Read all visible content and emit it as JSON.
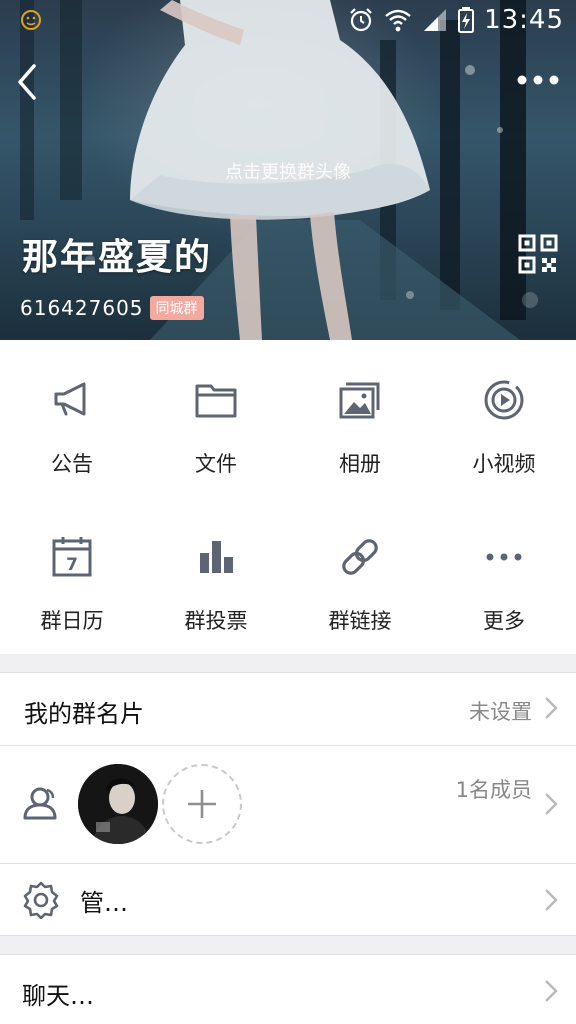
{
  "status_bar": {
    "time": "13:45",
    "icons": [
      "emoji-notification-icon",
      "alarm-icon",
      "wifi-icon",
      "cell-signal-icon",
      "battery-charging-icon"
    ]
  },
  "header": {
    "change_avatar_text": "点击更换群头像",
    "group_name": "那年盛夏的",
    "group_id": "616427605",
    "group_badge": "同城群",
    "badge_color": "#f3a99e"
  },
  "grid": {
    "items": [
      {
        "label": "公告",
        "icon": "megaphone-icon"
      },
      {
        "label": "文件",
        "icon": "folder-icon"
      },
      {
        "label": "相册",
        "icon": "photo-album-icon"
      },
      {
        "label": "小视频",
        "icon": "video-play-icon"
      },
      {
        "label": "群日历",
        "icon": "calendar-icon",
        "icon_text": "7"
      },
      {
        "label": "群投票",
        "icon": "bar-chart-icon"
      },
      {
        "label": "群链接",
        "icon": "link-icon"
      },
      {
        "label": "更多",
        "icon": "more-dots-icon"
      }
    ]
  },
  "group_card": {
    "label": "我的群名片",
    "value": "未设置"
  },
  "members": {
    "count_text": "1名成员"
  },
  "manage": {
    "label": "管…"
  },
  "chat": {
    "label": "聊天…"
  },
  "colors": {
    "icon_gray": "#5d6473",
    "divider": "#e2e2e4",
    "page_bg": "#f0f0f2"
  }
}
